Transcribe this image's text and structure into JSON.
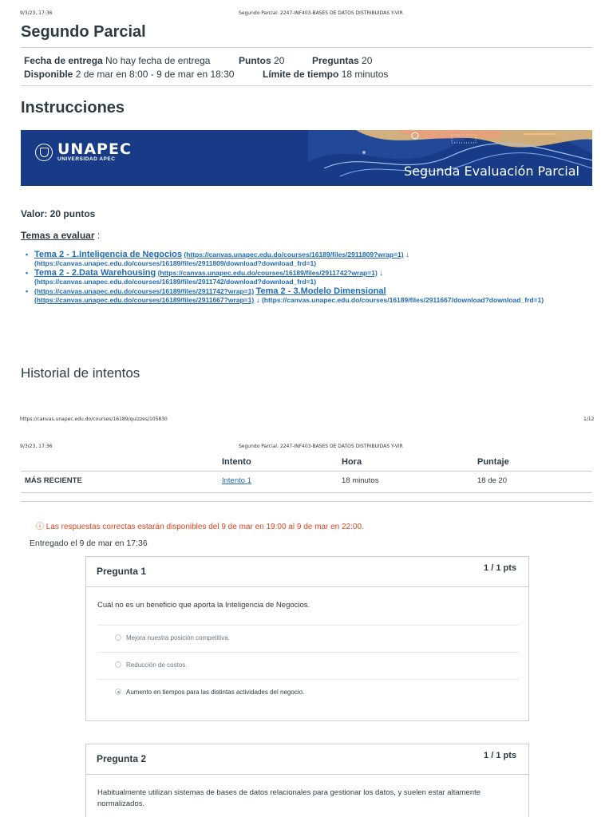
{
  "page1": {
    "header_date": "9/3/23, 17:36",
    "header_doc": "Segundo Parcial: 2247-INF403-BASES DE DATOS DISTRIBUIDAS Y-VIR",
    "footer_url": "https://canvas.unapec.edu.do/courses/16189/quizzes/105830",
    "footer_page": "1/12"
  },
  "page2": {
    "header_date": "9/3/23, 17:36",
    "header_doc": "Segundo Parcial: 2247-INF403-BASES DE DATOS DISTRIBUIDAS Y-VIR"
  },
  "quiz": {
    "title": "Segundo Parcial",
    "due_label": "Fecha de entrega",
    "due_value": "No hay fecha de entrega",
    "points_label": "Puntos",
    "points_value": "20",
    "questions_label": "Preguntas",
    "questions_value": "20",
    "available_label": "Disponible",
    "available_value": "2 de mar en 8:00 - 9 de mar en 18:30",
    "time_limit_label": "Límite de tiempo",
    "time_limit_value": "18 minutos"
  },
  "instructions": {
    "title": "Instrucciones",
    "banner_logo": "UNAPEC",
    "banner_logo_sub": "UNIVERSIDAD APEC",
    "banner_title": "Segunda Evaluación Parcial",
    "valor": "Valor: 20 puntos",
    "temas_label": "Temas a evaluar",
    "temas_suffix": " :",
    "topics": [
      {
        "title": "Tema 2 - 1.Inteligencia de Negocios",
        "url": "(https://canvas.unapec.edu.do/courses/16189/files/2911809?wrap=1)",
        "download_url": "(https://canvas.unapec.edu.do/courses/16189/files/2911809/download?download_frd=1)"
      },
      {
        "title": "Tema 2 - 2.Data Warehousing",
        "url": "(https://canvas.unapec.edu.do/courses/16189/files/2911742?wrap=1)",
        "download_url": "(https://canvas.unapec.edu.do/courses/16189/files/2911742/download?download_frd=1)"
      },
      {
        "pre_url": "(https://canvas.unapec.edu.do/courses/16189/files/2911742?wrap=1)",
        "title": "Tema 2 - 3.Modelo Dimensional",
        "url": "(https://canvas.unapec.edu.do/courses/16189/files/2911667?wrap=1)",
        "download_url": "(https://canvas.unapec.edu.do/courses/16189/files/2911667/download?download_frd=1)"
      }
    ],
    "download_glyph": "↓"
  },
  "history": {
    "title": "Historial de intentos",
    "headers": [
      "",
      "Intento",
      "Hora",
      "Puntaje"
    ],
    "rows": [
      {
        "label": "MÁS RECIENTE",
        "attempt": "Intento 1",
        "time": "18 minutos",
        "score": "18 de 20"
      }
    ]
  },
  "notice": {
    "icon": "ⓘ",
    "text": "Las respuestas correctas estarán disponibles del 9 de mar en 19:00 al 9 de mar en 22:00."
  },
  "submitted": "Entregado el 9 de mar en 17:36",
  "questions": [
    {
      "title": "Pregunta 1",
      "points": "1 / 1 pts",
      "text": "Cuál no es un beneficio que aporta la Inteligencia de Negocios.",
      "answers": [
        "Mejora nuestra posición competitiva.",
        "Reducción de costos.",
        "Aumento en tiempos para las distintas actividades del negocio."
      ],
      "selected_index": 2
    },
    {
      "title": "Pregunta 2",
      "points": "1 / 1 pts",
      "text": "Habitualmente utilizan sistemas de bases de datos relacionales para gestionar los datos, y suelen estar altamente normalizados."
    }
  ]
}
